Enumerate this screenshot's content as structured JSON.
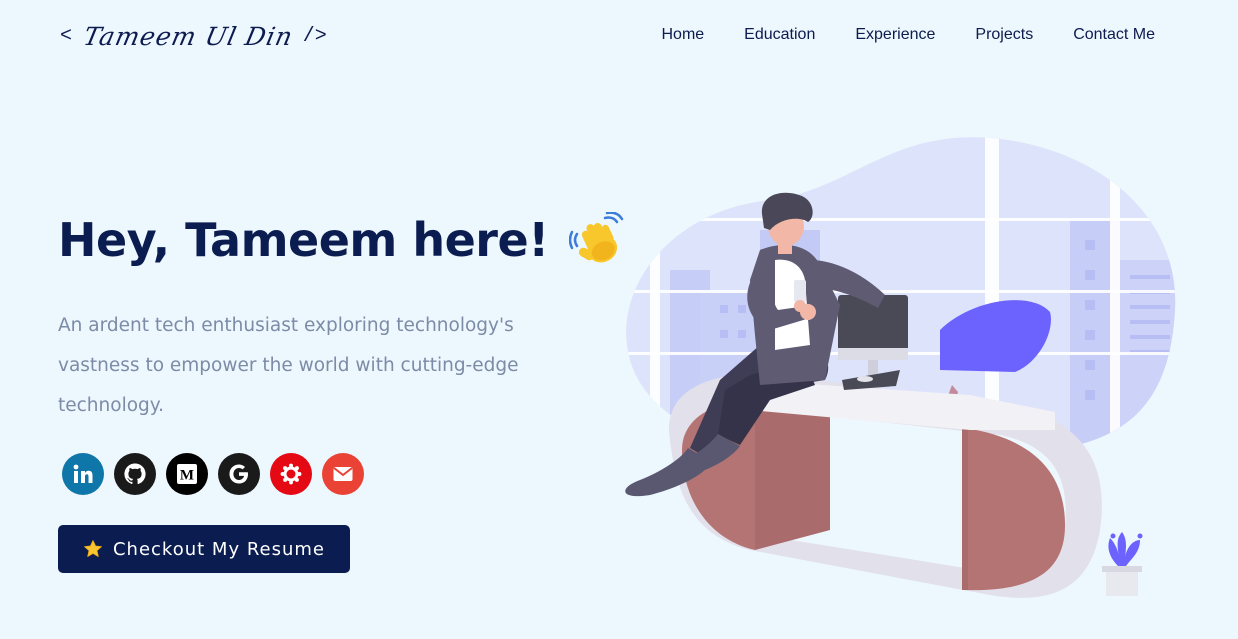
{
  "header": {
    "logo_open": "<",
    "logo_signature": "Tameem Ul Din",
    "logo_close": "/>",
    "nav": [
      {
        "label": "Home"
      },
      {
        "label": "Education"
      },
      {
        "label": "Experience"
      },
      {
        "label": "Projects"
      },
      {
        "label": "Contact Me"
      }
    ]
  },
  "hero": {
    "title": "Hey, Tameem here!",
    "wave_icon": "waving-hand-icon",
    "subtitle": "An ardent tech enthusiast exploring technology's vastness to empower the world with cutting-edge technology."
  },
  "socials": [
    {
      "name": "linkedin",
      "icon": "linkedin-icon",
      "color": "#0e76a8"
    },
    {
      "name": "github",
      "icon": "github-icon",
      "color": "#1a1a1a"
    },
    {
      "name": "medium",
      "icon": "medium-icon",
      "color": "#000000"
    },
    {
      "name": "google",
      "icon": "google-icon",
      "color": "#1a1a1a"
    },
    {
      "name": "badge",
      "icon": "badge-icon",
      "color": "#e50914"
    },
    {
      "name": "email",
      "icon": "email-icon",
      "color": "#ea4335"
    }
  ],
  "resume_button": {
    "label": "Checkout My Resume",
    "icon": "star-icon"
  },
  "colors": {
    "background": "#edf7fe",
    "primary": "#0b1d50",
    "subtitle": "#7c8ba6",
    "illustration_accent": "#6c63ff",
    "desk_leg": "#b47474"
  }
}
